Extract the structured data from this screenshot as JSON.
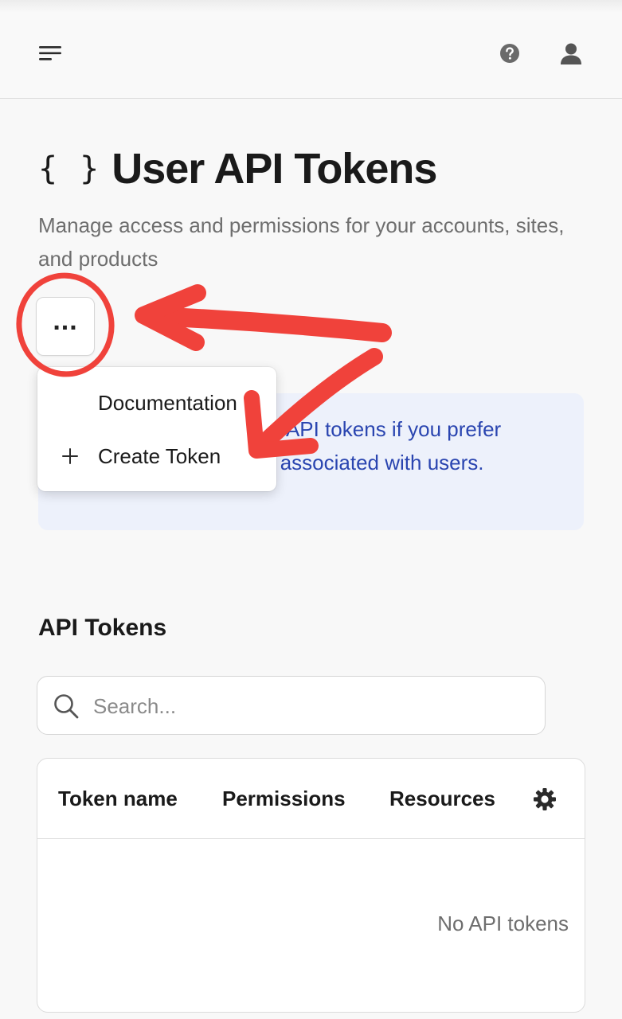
{
  "header": {
    "menu_icon": "hamburger-menu-icon",
    "help_icon": "help-circle-icon",
    "user_icon": "user-avatar-icon"
  },
  "page": {
    "title_glyph": "{ }",
    "title": "User API Tokens",
    "subtitle": "Manage access and permissions for your accounts, sites, and products"
  },
  "actions": {
    "more_label": "..."
  },
  "dropdown": {
    "items": [
      {
        "label": "Documentation",
        "icon": ""
      },
      {
        "label": "Create Token",
        "icon": "plus-icon"
      }
    ]
  },
  "info_box": {
    "text": "Consider using Account API tokens if you prefer credentials that are not associated with users."
  },
  "tokens": {
    "section_title": "API Tokens",
    "search_placeholder": "Search...",
    "columns": [
      "Token name",
      "Permissions",
      "Resources"
    ],
    "settings_icon": "gear-icon",
    "empty_message": "No API tokens"
  },
  "colors": {
    "accent_link": "#2a45b0",
    "info_bg": "#edf1fb",
    "annotation_red": "#f0423b"
  }
}
